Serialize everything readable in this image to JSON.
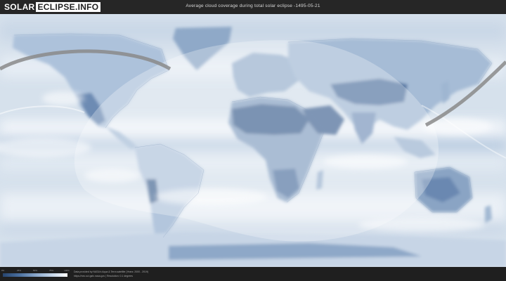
{
  "header": {
    "logo_left": "SOLAR",
    "logo_right": "ECLIPSE.INFO",
    "title": "Average cloud coverage during total solar eclipse -1495-05-21"
  },
  "legend": {
    "ticks": [
      "0%",
      "25%",
      "50%",
      "75%",
      "100%"
    ],
    "colors": [
      "#27456f",
      "#4a6f9e",
      "#87a4c8",
      "#c2d3e7",
      "#ffffff"
    ]
  },
  "footer": {
    "credit_line1": "Data provided by NASA's Aqua & Terra satellite (Years: 2000 - 2019)",
    "credit_line2": "https://neo.sci.gsfc.nasa.gov | Resolution: 0.1 degrees"
  },
  "map": {
    "projection": "equirectangular",
    "ocean_color": "#d9e4ef",
    "land_color": "#a9bfd8",
    "dry_land_color": "#5f7ea7",
    "eclipse_path_color": "#8a8a8a",
    "visibility_overlay_color": "#ffffff"
  }
}
